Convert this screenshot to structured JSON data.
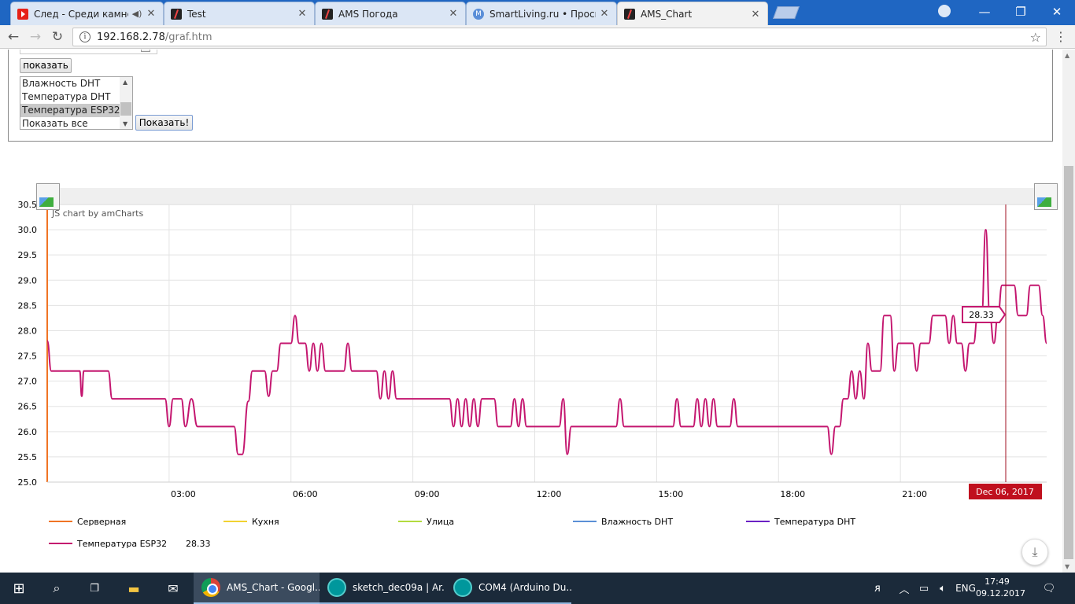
{
  "browser": {
    "tabs": [
      {
        "title": "След - Среди камней",
        "favicon": "youtube-icon",
        "audio": true
      },
      {
        "title": "Test",
        "favicon": "ams-icon"
      },
      {
        "title": "AMS Погода",
        "favicon": "ams-icon"
      },
      {
        "title": "SmartLiving.ru • Просмо",
        "favicon": "smartliving-icon"
      },
      {
        "title": "AMS_Chart",
        "favicon": "ams-icon",
        "active": true
      }
    ],
    "close_glyph": "✕",
    "url_host": "192.168.2.78",
    "url_path": "/graf.htm"
  },
  "form": {
    "show_button": "показать",
    "listbox_options": [
      "Влажность DHT",
      "Температура DHT",
      "Температура ESP32",
      "Показать все"
    ],
    "listbox_selected": "Температура ESP32",
    "submit_button": "Показать!"
  },
  "chart_data": {
    "type": "line",
    "credit": "JS chart by amCharts",
    "ylim": [
      25.0,
      30.5
    ],
    "y_ticks": [
      "25.0",
      "25.5",
      "26.0",
      "26.5",
      "27.0",
      "27.5",
      "28.0",
      "28.5",
      "29.0",
      "29.5",
      "30.0",
      "30.5"
    ],
    "x_ticks": [
      "03:00",
      "06:00",
      "09:00",
      "12:00",
      "15:00",
      "18:00",
      "21:00"
    ],
    "x_unit": "hours since 00:00, Dec 06, 2017",
    "cursor_date": "Dec 06, 2017",
    "cursor_value": "28.33",
    "grid": true,
    "legend_position": "bottom",
    "series": [
      {
        "name": "Серверная",
        "color": "#f07424",
        "values": []
      },
      {
        "name": "Кухня",
        "color": "#f2d232",
        "values": []
      },
      {
        "name": "Улица",
        "color": "#b3db3f",
        "values": []
      },
      {
        "name": "Влажность DHT",
        "color": "#5b8fd6",
        "values": []
      },
      {
        "name": "Температура DHT",
        "color": "#6b22c4",
        "values": []
      },
      {
        "name": "Температура ESP32",
        "color": "#c4166f",
        "value_label": "28.33",
        "points": [
          [
            0.0,
            27.8
          ],
          [
            0.1,
            27.2
          ],
          [
            0.8,
            27.2
          ],
          [
            0.85,
            26.7
          ],
          [
            0.9,
            27.2
          ],
          [
            1.5,
            27.2
          ],
          [
            1.6,
            26.65
          ],
          [
            2.9,
            26.65
          ],
          [
            3.0,
            26.1
          ],
          [
            3.1,
            26.65
          ],
          [
            3.3,
            26.65
          ],
          [
            3.4,
            26.1
          ],
          [
            3.55,
            26.65
          ],
          [
            3.7,
            26.1
          ],
          [
            4.6,
            26.1
          ],
          [
            4.7,
            25.55
          ],
          [
            4.8,
            25.55
          ],
          [
            4.95,
            26.6
          ],
          [
            5.05,
            27.2
          ],
          [
            5.35,
            27.2
          ],
          [
            5.45,
            26.7
          ],
          [
            5.55,
            27.2
          ],
          [
            5.65,
            27.2
          ],
          [
            5.75,
            27.75
          ],
          [
            6.0,
            27.75
          ],
          [
            6.1,
            28.3
          ],
          [
            6.2,
            27.75
          ],
          [
            6.35,
            27.75
          ],
          [
            6.45,
            27.2
          ],
          [
            6.55,
            27.75
          ],
          [
            6.65,
            27.2
          ],
          [
            6.75,
            27.75
          ],
          [
            6.85,
            27.2
          ],
          [
            7.3,
            27.2
          ],
          [
            7.4,
            27.75
          ],
          [
            7.5,
            27.2
          ],
          [
            8.1,
            27.2
          ],
          [
            8.2,
            26.65
          ],
          [
            8.3,
            27.2
          ],
          [
            8.4,
            26.65
          ],
          [
            8.5,
            27.2
          ],
          [
            8.6,
            26.65
          ],
          [
            9.9,
            26.65
          ],
          [
            10.0,
            26.1
          ],
          [
            10.1,
            26.65
          ],
          [
            10.2,
            26.1
          ],
          [
            10.3,
            26.65
          ],
          [
            10.4,
            26.1
          ],
          [
            10.5,
            26.65
          ],
          [
            10.6,
            26.1
          ],
          [
            10.7,
            26.65
          ],
          [
            11.0,
            26.65
          ],
          [
            11.1,
            26.1
          ],
          [
            11.4,
            26.1
          ],
          [
            11.5,
            26.65
          ],
          [
            11.6,
            26.1
          ],
          [
            11.7,
            26.65
          ],
          [
            11.8,
            26.1
          ],
          [
            12.6,
            26.1
          ],
          [
            12.7,
            26.65
          ],
          [
            12.8,
            25.55
          ],
          [
            12.9,
            26.1
          ],
          [
            14.0,
            26.1
          ],
          [
            14.1,
            26.65
          ],
          [
            14.2,
            26.1
          ],
          [
            15.4,
            26.1
          ],
          [
            15.5,
            26.65
          ],
          [
            15.6,
            26.1
          ],
          [
            15.9,
            26.1
          ],
          [
            16.0,
            26.65
          ],
          [
            16.1,
            26.1
          ],
          [
            16.2,
            26.65
          ],
          [
            16.3,
            26.1
          ],
          [
            16.4,
            26.65
          ],
          [
            16.5,
            26.1
          ],
          [
            16.8,
            26.1
          ],
          [
            16.9,
            26.65
          ],
          [
            17.0,
            26.1
          ],
          [
            19.2,
            26.1
          ],
          [
            19.3,
            25.55
          ],
          [
            19.4,
            26.1
          ],
          [
            19.5,
            26.1
          ],
          [
            19.6,
            26.65
          ],
          [
            19.7,
            26.65
          ],
          [
            19.8,
            27.2
          ],
          [
            19.9,
            26.65
          ],
          [
            20.0,
            27.2
          ],
          [
            20.1,
            26.65
          ],
          [
            20.2,
            27.75
          ],
          [
            20.3,
            27.2
          ],
          [
            20.5,
            27.2
          ],
          [
            20.6,
            28.3
          ],
          [
            20.75,
            28.3
          ],
          [
            20.85,
            27.2
          ],
          [
            20.95,
            27.75
          ],
          [
            21.3,
            27.75
          ],
          [
            21.4,
            27.2
          ],
          [
            21.5,
            27.75
          ],
          [
            21.7,
            27.75
          ],
          [
            21.8,
            28.3
          ],
          [
            22.1,
            28.3
          ],
          [
            22.2,
            27.75
          ],
          [
            22.3,
            28.3
          ],
          [
            22.4,
            27.75
          ],
          [
            22.5,
            27.75
          ],
          [
            22.6,
            27.2
          ],
          [
            22.7,
            27.75
          ],
          [
            22.8,
            27.75
          ],
          [
            22.9,
            28.3
          ],
          [
            23.0,
            28.3
          ],
          [
            23.1,
            30.0
          ],
          [
            23.2,
            28.3
          ],
          [
            23.3,
            27.75
          ],
          [
            23.4,
            28.3
          ],
          [
            23.5,
            28.9
          ],
          [
            23.8,
            28.9
          ],
          [
            23.9,
            28.3
          ],
          [
            24.1,
            28.3
          ],
          [
            24.2,
            28.9
          ],
          [
            24.4,
            28.9
          ],
          [
            24.5,
            28.3
          ],
          [
            24.6,
            27.75
          ]
        ]
      }
    ]
  }
}
